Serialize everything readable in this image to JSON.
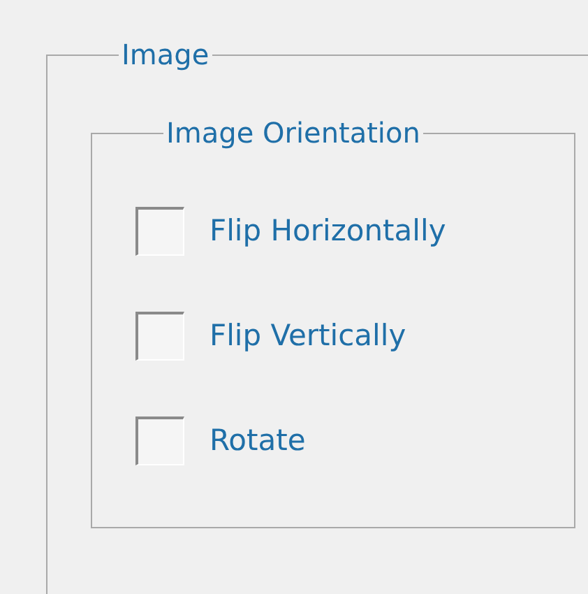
{
  "group": {
    "title": "Image"
  },
  "orientation": {
    "title": "Image Orientation",
    "options": [
      {
        "label": "Flip Horizontally",
        "checked": false
      },
      {
        "label": "Flip Vertically",
        "checked": false
      },
      {
        "label": "Rotate",
        "checked": false
      }
    ]
  }
}
